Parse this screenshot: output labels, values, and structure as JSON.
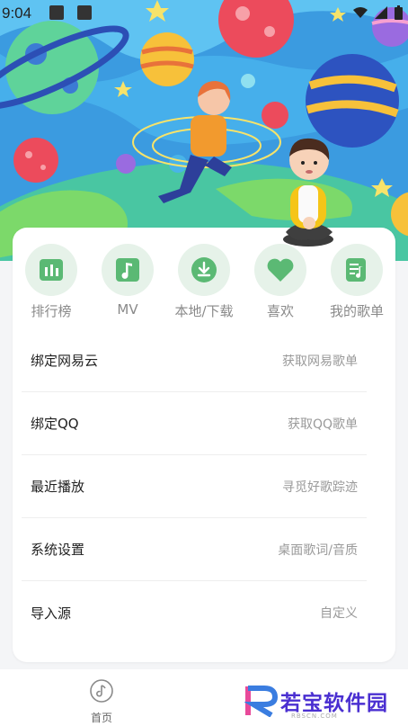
{
  "status_bar": {
    "time": "9:04"
  },
  "quick_actions": [
    {
      "label": "排行榜",
      "icon": "chart-bars-icon"
    },
    {
      "label": "MV",
      "icon": "music-note-icon"
    },
    {
      "label": "本地/下载",
      "icon": "download-icon"
    },
    {
      "label": "喜欢",
      "icon": "heart-icon"
    },
    {
      "label": "我的歌单",
      "icon": "playlist-icon"
    }
  ],
  "menu": [
    {
      "title": "绑定网易云",
      "subtitle": "获取网易歌单"
    },
    {
      "title": "绑定QQ",
      "subtitle": "获取QQ歌单"
    },
    {
      "title": "最近播放",
      "subtitle": "寻觅好歌踪迹"
    },
    {
      "title": "系统设置",
      "subtitle": "桌面歌词/音质"
    },
    {
      "title": "导入源",
      "subtitle": "自定义"
    }
  ],
  "bottom_nav": {
    "home_label": "首页"
  },
  "watermark": {
    "brand": "若宝软件园",
    "domain": "RBSCN.COM"
  },
  "colors": {
    "accent_green": "#5bb974",
    "icon_bg": "#e6f2e9",
    "watermark": "#4a2fd1"
  }
}
